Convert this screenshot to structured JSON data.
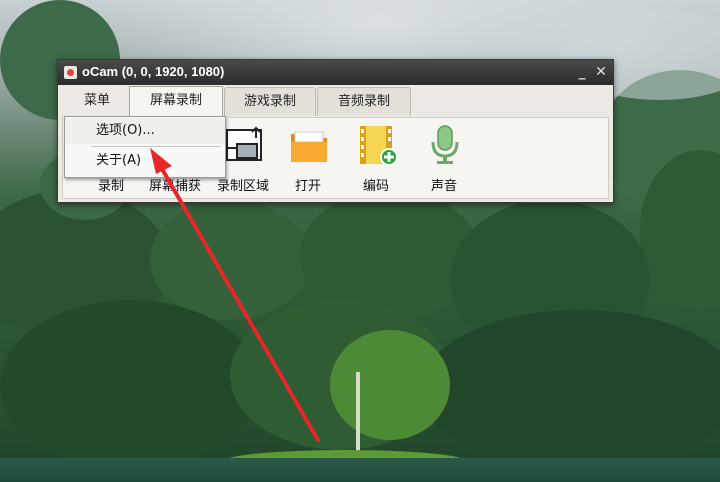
{
  "window": {
    "title": "oCam (0, 0, 1920, 1080)",
    "minimize_symbol": "_",
    "close_symbol": "✕"
  },
  "tabs": {
    "menu": "菜单",
    "screen": "屏幕录制",
    "game": "游戏录制",
    "audio": "音频录制"
  },
  "toolbar": {
    "items": [
      {
        "label": "录制",
        "icon": "record-icon"
      },
      {
        "label": "屏幕捕获",
        "icon": "screen-capture-icon"
      },
      {
        "label": "录制区域",
        "icon": "record-area-icon"
      },
      {
        "label": "打开",
        "icon": "folder-icon"
      },
      {
        "label": "编码",
        "icon": "codec-icon"
      },
      {
        "label": "声音",
        "icon": "microphone-icon"
      }
    ]
  },
  "dropdown": {
    "options_label": "选项(O)...",
    "about_label": "关于(A)"
  },
  "colors": {
    "titlebar": "#2c2c2c",
    "folder": "#f29a1c",
    "arrow": "#e8262a"
  }
}
